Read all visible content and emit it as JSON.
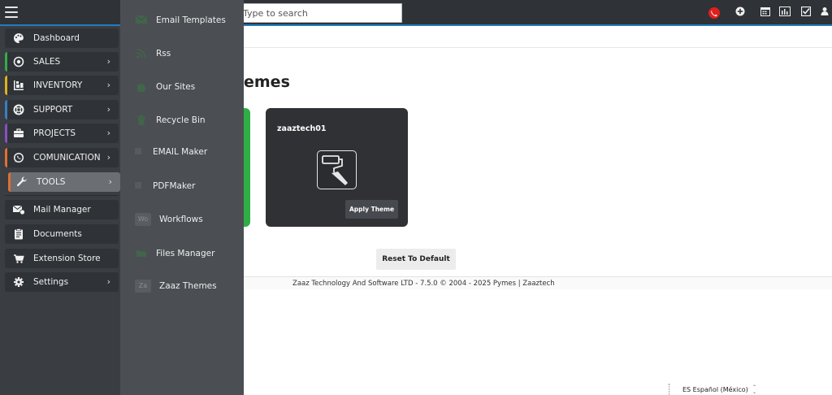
{
  "topbar": {
    "search_placeholder": "Type to search",
    "icons": [
      "menu-icon",
      "phone-icon",
      "plus-circle-icon",
      "calendar-icon",
      "chart-icon",
      "checkbox-icon",
      "user-icon"
    ],
    "accent_color": "#1f7fbf"
  },
  "sidebar": {
    "items": [
      {
        "label": "Dashboard",
        "icon": "palette-icon",
        "color": ""
      },
      {
        "label": "SALES",
        "icon": "target-icon",
        "color": "#2fae46"
      },
      {
        "label": "INVENTORY",
        "icon": "inventory-icon",
        "color": "#e0b020"
      },
      {
        "label": "SUPPORT",
        "icon": "lifebuoy-icon",
        "color": "#3a7fc1"
      },
      {
        "label": "PROJECTS",
        "icon": "briefcase-icon",
        "color": "#8a4fc0"
      },
      {
        "label": "COMUNICATION",
        "icon": "whatsapp-icon",
        "color": "#e07030"
      },
      {
        "label": "TOOLS",
        "icon": "wrench-icon",
        "color": "#e07030"
      },
      {
        "label": "Mail Manager",
        "icon": "mail-icon",
        "color": ""
      },
      {
        "label": "Documents",
        "icon": "document-icon",
        "color": ""
      },
      {
        "label": "Extension Store",
        "icon": "cart-icon",
        "color": ""
      },
      {
        "label": "Settings",
        "icon": "gear-icon",
        "color": ""
      }
    ]
  },
  "flyout": {
    "items": [
      {
        "label": "Email Templates",
        "icon": "email-icon"
      },
      {
        "label": "Rss",
        "icon": "rss-icon"
      },
      {
        "label": "Our Sites",
        "icon": "puzzle-icon"
      },
      {
        "label": "Recycle Bin",
        "icon": "trash-icon"
      },
      {
        "label": "EMAIL Maker",
        "icon": "email-maker-icon"
      },
      {
        "label": "PDFMaker",
        "icon": "pdf-icon"
      },
      {
        "label": "Workflows",
        "box": "Wo"
      },
      {
        "label": "Files Manager",
        "icon": "files-icon"
      },
      {
        "label": "Zaaz Themes",
        "box": "Za"
      }
    ]
  },
  "main": {
    "title_visible": "emes",
    "theme_card": {
      "name": "zaaztech01",
      "icon": "paint-roller-icon",
      "apply_label": "Apply Theme"
    },
    "reset_label": "Reset To Default",
    "footer": "Zaaz Technology And Software LTD - 7.5.0  © 2004 - 2025   Pymes |  Zaaztech"
  },
  "bottom": {
    "language": "ES Español (México)"
  }
}
